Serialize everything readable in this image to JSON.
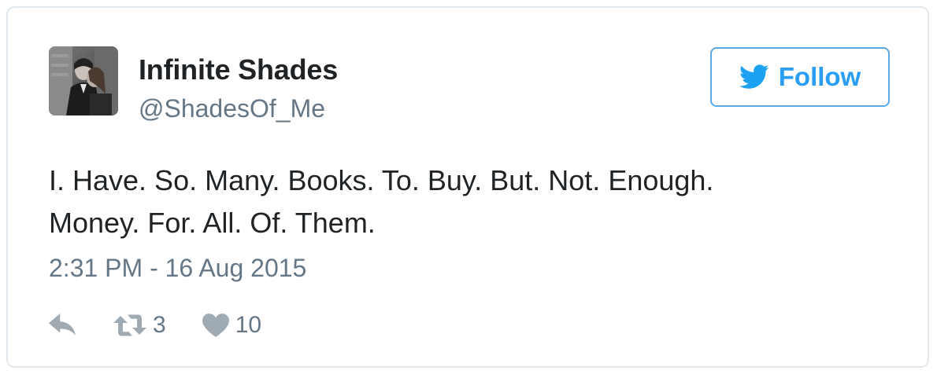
{
  "user": {
    "display_name": "Infinite Shades",
    "screen_name": "@ShadesOf_Me"
  },
  "follow_button": {
    "label": "Follow",
    "icon": "twitter-bird-icon"
  },
  "tweet": {
    "text_lines": [
      "I. Have. So. Many. Books. To. Buy. But. Not. Enough.",
      "Money. For. All. Of. Them."
    ],
    "timestamp": "2:31 PM - 16 Aug 2015"
  },
  "actions": {
    "reply_icon": "reply-icon",
    "retweet_icon": "retweet-icon",
    "retweet_count": "3",
    "like_icon": "heart-icon",
    "like_count": "10"
  },
  "colors": {
    "accent": "#1da1f2",
    "text": "#1f2326",
    "muted": "#657786",
    "border": "#e1e8ed"
  }
}
